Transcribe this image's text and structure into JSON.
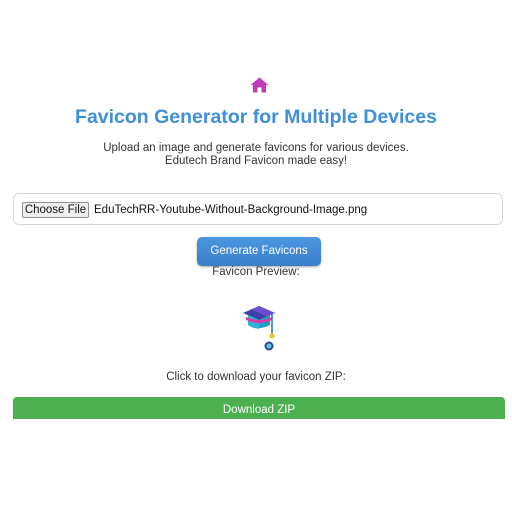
{
  "header": {
    "icon": "home-icon",
    "title": "Favicon Generator for Multiple Devices",
    "subtitle_line1": "Upload an image and generate favicons for various devices.",
    "subtitle_line2": "Edutech Brand Favicon made easy!"
  },
  "upload": {
    "choose_label": "Choose File",
    "file_name": "EduTechRR-Youtube-Without-Background-Image.png"
  },
  "actions": {
    "generate_label": "Generate Favicons",
    "preview_label": "Favicon Preview:",
    "download_prompt": "Click to download your favicon ZIP:",
    "download_label": "Download ZIP"
  },
  "colors": {
    "title": "#3f8fdc",
    "home_icon": "#c03cb8",
    "generate_button": "#4a90d9",
    "download_button": "#4caf50"
  }
}
